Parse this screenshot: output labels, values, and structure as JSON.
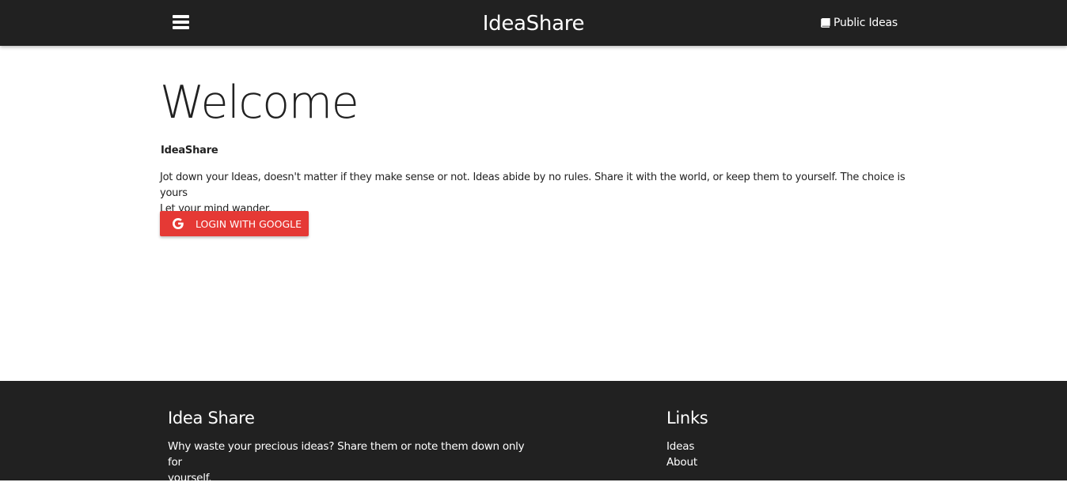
{
  "navbar": {
    "brand": "IdeaShare",
    "menu_icon": "hamburger-menu-icon",
    "public_ideas_icon": "book-icon",
    "public_ideas_label": "Public Ideas"
  },
  "main": {
    "heading": "Welcome",
    "subheading": "IdeaShare",
    "description_line1": "Jot down your Ideas, doesn't matter if they make sense or not. Ideas abide by no rules. Share it with the world, or keep them to yourself. The choice is yours",
    "description_line2": "Let your mind wander.",
    "login_icon": "google-g-icon",
    "login_label": "LOGIN WITH GOOGLE"
  },
  "footer": {
    "about_title": "Idea Share",
    "about_text_line1": "Why waste your precious ideas? Share them or note them down only for",
    "about_text_line2": "yourself.",
    "links_title": "Links",
    "links": [
      "Ideas",
      "About"
    ]
  },
  "colors": {
    "nav_bg": "#212121",
    "footer_bg": "#212121",
    "accent_red": "#e53935",
    "text": "#212121"
  }
}
